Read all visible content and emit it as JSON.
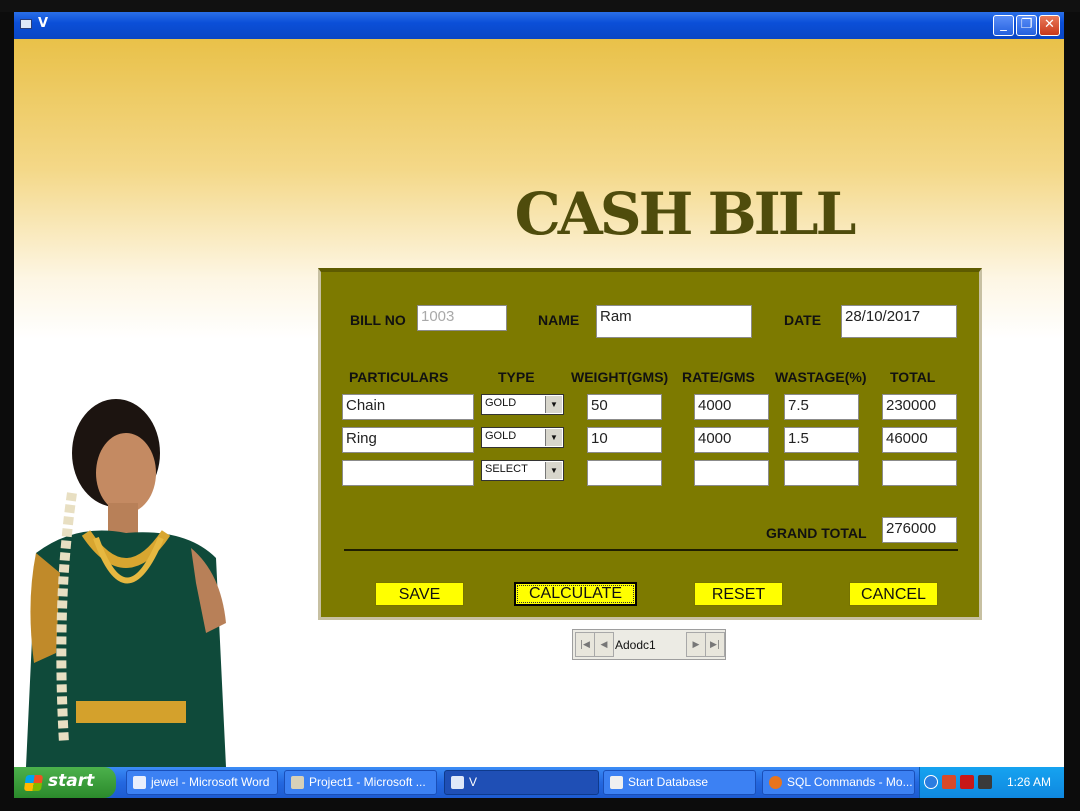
{
  "window": {
    "title": "V",
    "buttons": [
      "minimize",
      "restore",
      "close"
    ]
  },
  "form": {
    "heading": "CASH BILL",
    "bill_no_label": "BILL NO",
    "bill_no_value": "1003",
    "name_label": "NAME",
    "name_value": "Ram",
    "date_label": "DATE",
    "date_value": "28/10/2017",
    "columns": [
      "PARTICULARS",
      "TYPE",
      "WEIGHT(GMS)",
      "RATE/GMS",
      "WASTAGE(%)",
      "TOTAL"
    ],
    "rows": [
      {
        "particulars": "Chain",
        "type": "GOLD",
        "weight": "50",
        "rate": "4000",
        "wastage": "7.5",
        "total": "230000"
      },
      {
        "particulars": "Ring",
        "type": "GOLD",
        "weight": "10",
        "rate": "4000",
        "wastage": "1.5",
        "total": "46000"
      },
      {
        "particulars": "",
        "type": "SELECT",
        "weight": "",
        "rate": "",
        "wastage": "",
        "total": ""
      }
    ],
    "grand_total_label": "GRAND TOTAL",
    "grand_total_value": "276000",
    "buttons": {
      "save": "SAVE",
      "calculate": "CALCULATE",
      "reset": "RESET",
      "cancel": "CANCEL"
    }
  },
  "adodc": {
    "caption": "Adodc1",
    "nav_icons": [
      "first-record-icon",
      "prev-record-icon",
      "next-record-icon",
      "last-record-icon"
    ]
  },
  "taskbar": {
    "start_label": "start",
    "tasks": [
      {
        "label": "jewel - Microsoft Word",
        "icon": "word-icon"
      },
      {
        "label": "Project1 - Microsoft ...",
        "icon": "vb-project-icon"
      },
      {
        "label": "V",
        "icon": "form-window-icon",
        "active": true
      },
      {
        "label": "Start Database",
        "icon": "database-icon"
      },
      {
        "label": "SQL Commands - Mo...",
        "icon": "firefox-icon"
      }
    ],
    "clock": "1:26 AM"
  },
  "colors": {
    "panel": "#7d7a00",
    "button_yellow": "#ffff00",
    "heading": "#4f4c0c",
    "titlebar": "#0b4fd8"
  }
}
